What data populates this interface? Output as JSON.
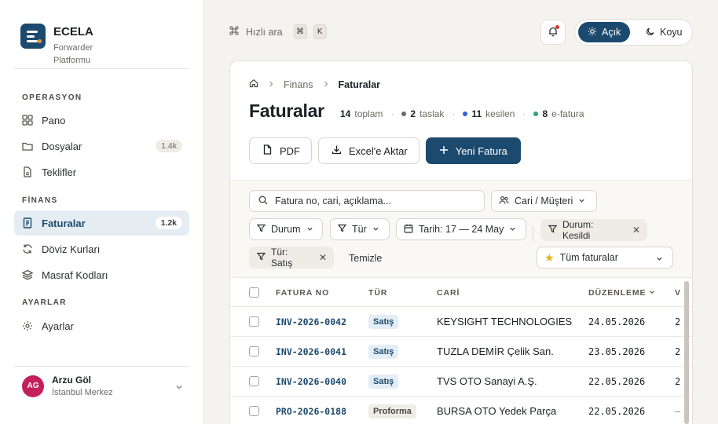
{
  "brand": {
    "name": "ECELA",
    "subtitle": "Forwarder Platformu"
  },
  "sidebar": {
    "sections": [
      {
        "title": "OPERASYON"
      },
      {
        "title": "FİNANS"
      },
      {
        "title": "AYARLAR"
      }
    ],
    "items": [
      {
        "label": "Pano",
        "icon": "grid-icon"
      },
      {
        "label": "Dosyalar",
        "icon": "folder-icon",
        "badge": "1.4k"
      },
      {
        "label": "Teklifler",
        "icon": "document-icon"
      },
      {
        "label": "Faturalar",
        "icon": "invoice-icon",
        "badge": "1.2k",
        "active": true
      },
      {
        "label": "Döviz Kurları",
        "icon": "refresh-icon"
      },
      {
        "label": "Masraf Kodları",
        "icon": "layers-icon"
      },
      {
        "label": "Ayarlar",
        "icon": "gear-icon"
      }
    ],
    "user": {
      "initials": "AG",
      "name": "Arzu Göl",
      "location": "İstanbul Merkez"
    }
  },
  "topbar": {
    "quick_search": "Hızlı ara",
    "kbd": [
      "⌘",
      "K"
    ],
    "theme": {
      "light": "Açık",
      "dark": "Koyu"
    }
  },
  "breadcrumb": {
    "parent": "Finans",
    "current": "Faturalar"
  },
  "page": {
    "title": "Faturalar",
    "stats": [
      {
        "value": "14",
        "label": "toplam"
      },
      {
        "value": "2",
        "label": "taslak",
        "color": "#6f6a62"
      },
      {
        "value": "11",
        "label": "kesilen",
        "color": "#2f5fd6"
      },
      {
        "value": "8",
        "label": "e-fatura",
        "color": "#2fa27a"
      }
    ]
  },
  "actions": {
    "pdf": "PDF",
    "excel": "Excel'e Aktar",
    "new": "Yeni Fatura"
  },
  "filters": {
    "search_placeholder": "Fatura no, cari, açıklama...",
    "cari": "Cari / Müşteri",
    "durum": "Durum",
    "tur": "Tür",
    "tarih": "Tarih: 17 — 24 May",
    "applied": [
      {
        "line1": "Durum:",
        "line2": "Kesildi"
      },
      {
        "line1": "Tür:",
        "line2": "Satış"
      }
    ],
    "clear": "Temizle",
    "saved_view": "Tüm faturalar"
  },
  "table": {
    "headers": {
      "no": "FATURA NO",
      "type": "TÜR",
      "cari": "CARİ",
      "date": "DÜZENLEME",
      "next": "V"
    },
    "rows": [
      {
        "no": "INV-2026-0042",
        "type": "Satış",
        "cari": "KEYSIGHT TECHNOLOGIES",
        "date": "24.05.2026",
        "next": "2"
      },
      {
        "no": "INV-2026-0041",
        "type": "Satış",
        "cari": "TUZLA DEMİR Çelik San.",
        "date": "23.05.2026",
        "next": "2"
      },
      {
        "no": "INV-2026-0040",
        "type": "Satış",
        "cari": "TVS OTO Sanayi A.Ş.",
        "date": "22.05.2026",
        "next": "2"
      },
      {
        "no": "PRO-2026-0188",
        "type": "Proforma",
        "cari": "BURSA OTO Yedek Parça",
        "date": "22.05.2026",
        "next": "—"
      }
    ]
  }
}
